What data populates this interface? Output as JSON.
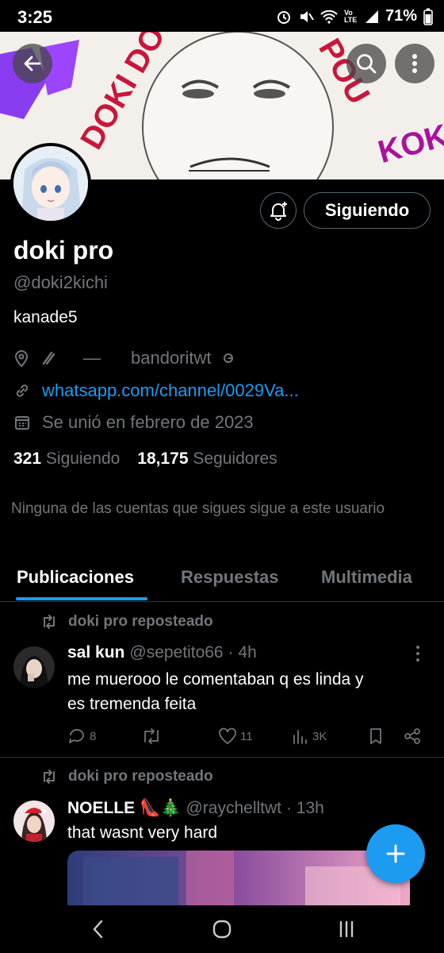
{
  "status_bar": {
    "time": "3:25",
    "battery": "71%",
    "network": "Vo LTE"
  },
  "profile": {
    "name": "doki pro",
    "handle": "@doki2kichi",
    "bio": "kanade5",
    "location": "—",
    "location_extra": "bandoritwt",
    "link": "whatsapp.com/channel/0029Va...",
    "joined": "Se unió en febrero de 2023",
    "following_count": "321",
    "following_label": "Siguiendo",
    "followers_count": "18,175",
    "followers_label": "Seguidores",
    "mutuals_note": "Ninguna de las cuentas que sigues sigue a este usuario"
  },
  "banner": {
    "texts": [
      "DOKI DOKI",
      "POU",
      "KOK"
    ]
  },
  "buttons": {
    "following": "Siguiendo"
  },
  "tabs": [
    {
      "label": "Publicaciones",
      "active": true
    },
    {
      "label": "Respuestas",
      "active": false
    },
    {
      "label": "Multimedia",
      "active": false
    }
  ],
  "posts": [
    {
      "repost_label": "doki pro reposteado",
      "author": "sal kun",
      "handle": "@sepetito66",
      "time": "· 4h",
      "text_line1": "me muerooo le comentaban q es linda y",
      "text_line2": "es tremenda feita",
      "replies": "8",
      "reposts": "",
      "likes": "11",
      "views": "3K"
    },
    {
      "repost_label": "doki pro reposteado",
      "author": "NOELLE",
      "author_emoji": "👠🎄",
      "handle": "@raychelltwt",
      "time": "· 13h",
      "text": "that wasnt very hard"
    }
  ],
  "colors": {
    "accent": "#1d9bf0",
    "background": "#000000",
    "muted_text": "#71767b",
    "divider": "#2f3336"
  }
}
